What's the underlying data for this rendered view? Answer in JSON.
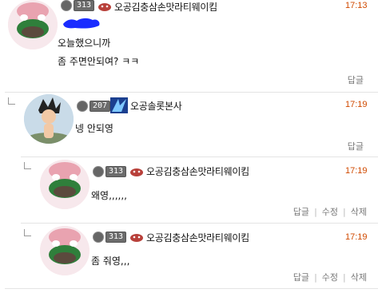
{
  "comments": [
    {
      "level": "313",
      "nickname": "오공김충삼손맛라티웨이킴",
      "time": "17:13",
      "lines": [
        "오늘했으니까",
        "좀 주면안되여? ㅋㅋ"
      ],
      "actions": [
        "답글"
      ]
    },
    {
      "level": "207",
      "nickname": "오공솔롯본사",
      "time": "17:19",
      "lines": [
        "넹 안되영"
      ],
      "actions": [
        "답글"
      ]
    },
    {
      "level": "313",
      "nickname": "오공김충삼손맛라티웨이킴",
      "time": "17:19",
      "lines": [
        "왜영,,,,,,"
      ],
      "actions": [
        "답글",
        "수정",
        "삭제"
      ]
    },
    {
      "level": "313",
      "nickname": "오공김충삼손맛라티웨이킴",
      "time": "17:19",
      "lines": [
        "좀 줘영,,,"
      ],
      "actions": [
        "답글",
        "수정",
        "삭제"
      ]
    }
  ],
  "colors": {
    "time": "#d04a00",
    "redact": "#1a2cff"
  }
}
